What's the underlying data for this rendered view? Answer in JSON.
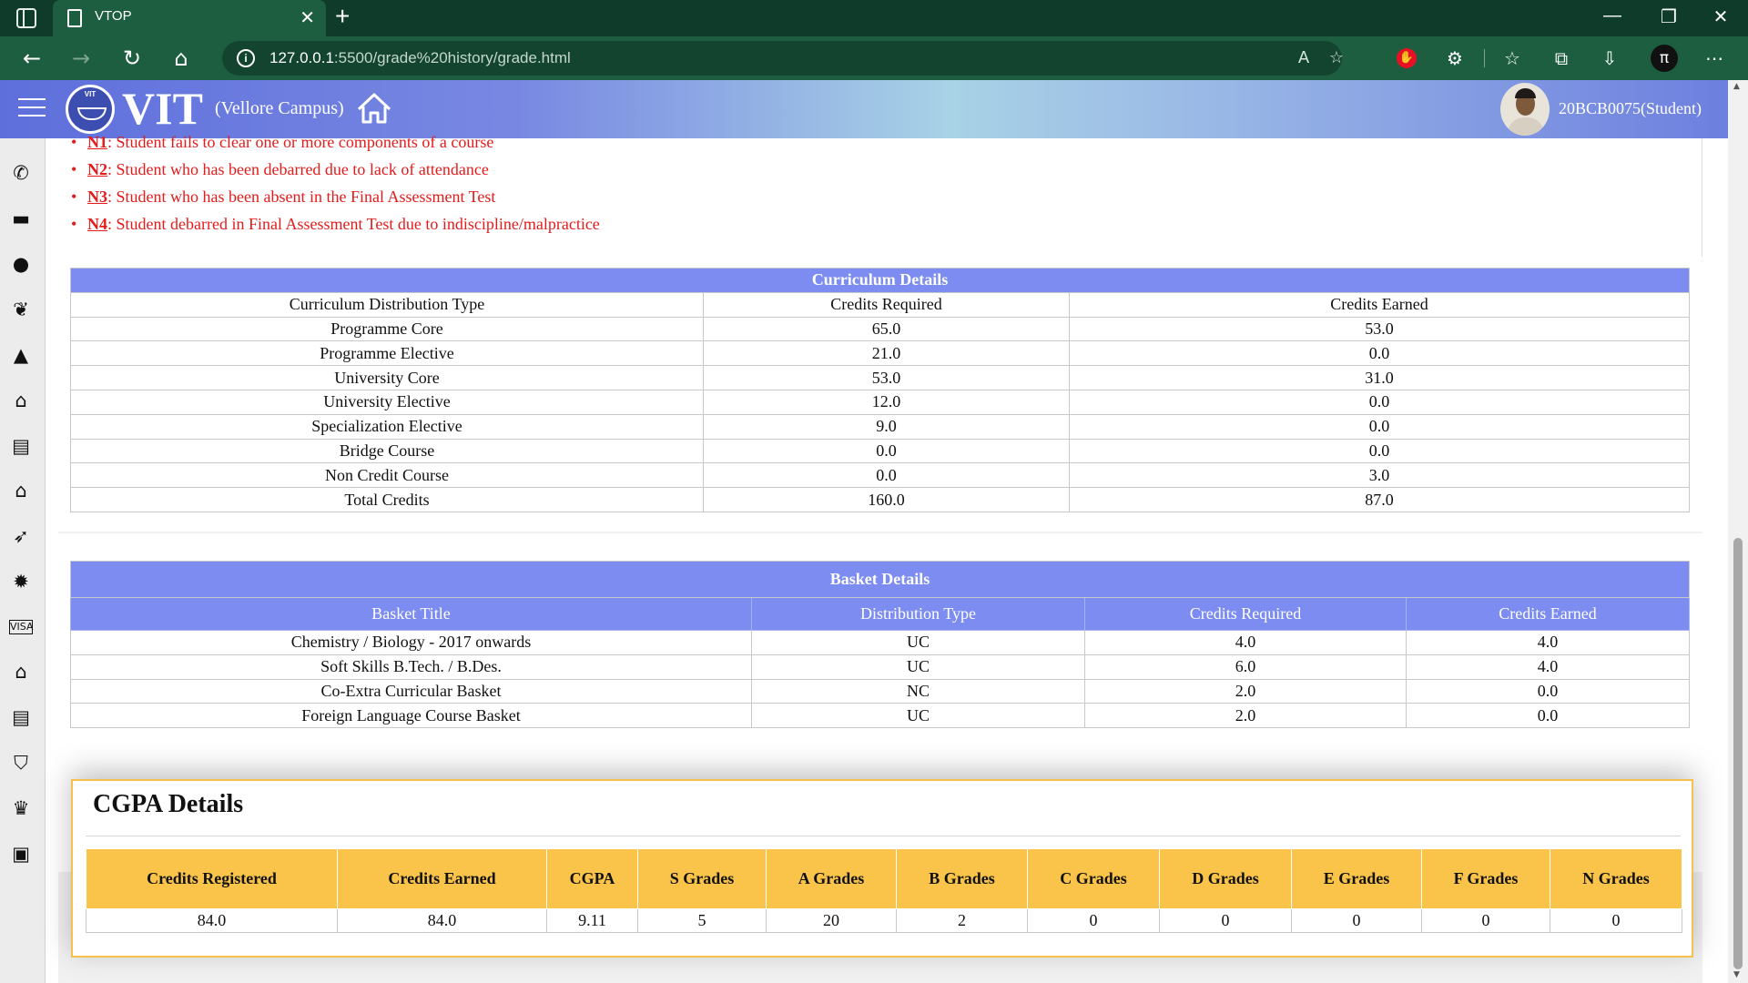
{
  "browser": {
    "tab_title": "VTOP",
    "tab_close": "✕",
    "new_tab": "+",
    "url_host": "127.0.0.1",
    "url_rest": ":5500/grade%20history/grade.html",
    "window_controls": {
      "minimize": "—",
      "restore": "❐",
      "close": "✕"
    }
  },
  "header": {
    "logo_text": "VIT",
    "title": "VIT",
    "campus": "(Vellore Campus)",
    "user_id": "20BCB0075(Student)"
  },
  "sidebar_icons": [
    "phone-icon",
    "briefcase-icon",
    "info-icon",
    "paw-icon",
    "graduation-cap-icon",
    "bank-icon",
    "book-icon",
    "bank-icon",
    "rocket-icon",
    "gear-icon",
    "visa-card-icon",
    "home-icon",
    "book-icon",
    "shield-icon",
    "trophy-icon",
    "lock-icon"
  ],
  "notes": [
    {
      "code": "N1",
      "text": ": Student fails to clear one or more components of a course"
    },
    {
      "code": "N2",
      "text": ": Student who has been debarred due to lack of attendance"
    },
    {
      "code": "N3",
      "text": ": Student who has been absent in the Final Assessment Test"
    },
    {
      "code": "N4",
      "text": ": Student debarred in Final Assessment Test due to indiscipline/malpractice"
    }
  ],
  "curriculum": {
    "title": "Curriculum Details",
    "headers": [
      "Curriculum Distribution Type",
      "Credits Required",
      "Credits Earned"
    ],
    "rows": [
      [
        "Programme Core",
        "65.0",
        "53.0"
      ],
      [
        "Programme Elective",
        "21.0",
        "0.0"
      ],
      [
        "University Core",
        "53.0",
        "31.0"
      ],
      [
        "University Elective",
        "12.0",
        "0.0"
      ],
      [
        "Specialization Elective",
        "9.0",
        "0.0"
      ],
      [
        "Bridge Course",
        "0.0",
        "0.0"
      ],
      [
        "Non Credit Course",
        "0.0",
        "3.0"
      ],
      [
        "Total Credits",
        "160.0",
        "87.0"
      ]
    ]
  },
  "basket": {
    "title": "Basket Details",
    "headers": [
      "Basket Title",
      "Distribution Type",
      "Credits Required",
      "Credits Earned"
    ],
    "rows": [
      [
        "Chemistry / Biology - 2017 onwards",
        "UC",
        "4.0",
        "4.0"
      ],
      [
        "Soft Skills B.Tech. / B.Des.",
        "UC",
        "6.0",
        "4.0"
      ],
      [
        "Co-Extra Curricular Basket",
        "NC",
        "2.0",
        "0.0"
      ],
      [
        "Foreign Language Course Basket",
        "UC",
        "2.0",
        "0.0"
      ]
    ]
  },
  "cgpa": {
    "title": "CGPA Details",
    "headers": [
      "Credits Registered",
      "Credits Earned",
      "CGPA",
      "S Grades",
      "A Grades",
      "B Grades",
      "C Grades",
      "D Grades",
      "E Grades",
      "F Grades",
      "N Grades"
    ],
    "values": [
      "84.0",
      "84.0",
      "9.11",
      "5",
      "20",
      "2",
      "0",
      "0",
      "0",
      "0",
      "0"
    ]
  },
  "colors": {
    "browser_frame": "#1c5e3f",
    "table_header": "#7c8cf0",
    "cgpa_header": "#f9c449",
    "note_text": "#e41b1b"
  }
}
